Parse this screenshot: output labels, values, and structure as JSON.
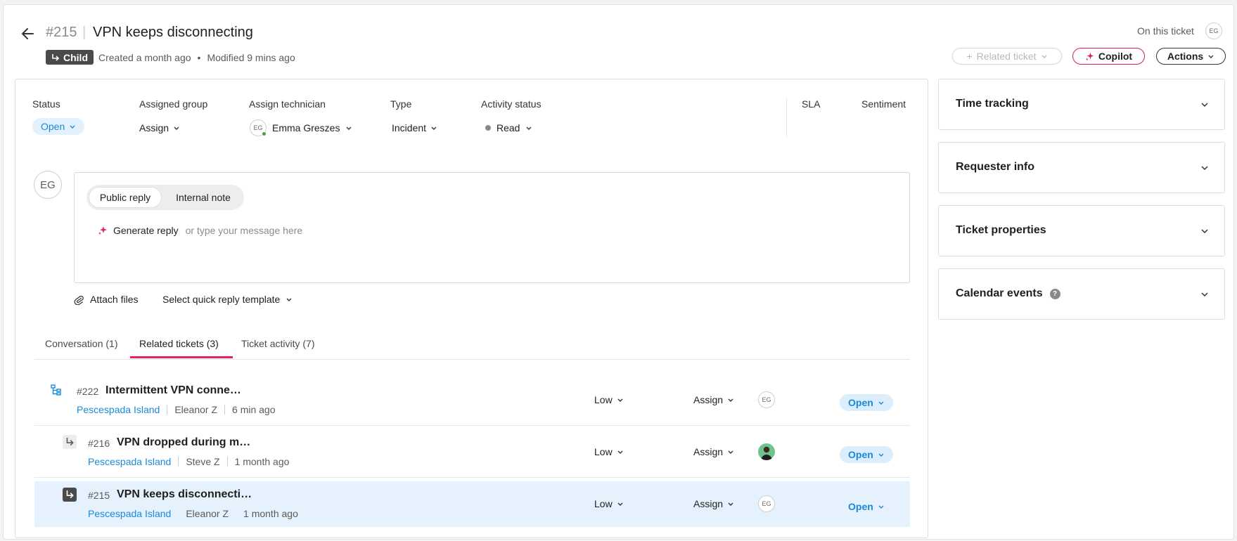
{
  "ticket": {
    "number": "#215",
    "separator": "|",
    "title": "VPN keeps disconnecting",
    "badge": "Child",
    "created": "Created a month ago",
    "dot": "•",
    "modified": "Modified 9 mins ago"
  },
  "header_right": {
    "on_this_ticket": "On this ticket",
    "avatar": "EG",
    "related_ticket": "Related ticket",
    "copilot": "Copilot",
    "actions": "Actions"
  },
  "fields": {
    "status_label": "Status",
    "status_value": "Open",
    "group_label": "Assigned group",
    "group_value": "Assign",
    "tech_label": "Assign technician",
    "tech_avatar": "EG",
    "tech_value": "Emma Greszes",
    "type_label": "Type",
    "type_value": "Incident",
    "activity_label": "Activity status",
    "activity_value": "Read",
    "sla_label": "SLA",
    "sentiment_label": "Sentiment"
  },
  "composer": {
    "avatar": "EG",
    "public_reply": "Public reply",
    "internal_note": "Internal note",
    "generate_reply": "Generate reply",
    "placeholder": "or type your message here",
    "attach_files": "Attach files",
    "quick_reply": "Select quick reply template"
  },
  "tabs": [
    {
      "label": "Conversation (1)"
    },
    {
      "label": "Related tickets (3)"
    },
    {
      "label": "Ticket activity (7)"
    }
  ],
  "related": [
    {
      "num": "#222",
      "title": "Intermittent VPN conne…",
      "site": "Pescespada Island",
      "person": "Eleanor Z",
      "time": "6 min ago",
      "priority": "Low",
      "assign": "Assign",
      "avatar": "EG",
      "status": "Open"
    },
    {
      "num": "#216",
      "title": "VPN dropped during m…",
      "site": "Pescespada Island",
      "person": "Steve Z",
      "time": "1 month ago",
      "priority": "Low",
      "assign": "Assign",
      "avatar": "",
      "status": "Open"
    },
    {
      "num": "#215",
      "title": "VPN keeps disconnecti…",
      "site": "Pescespada Island",
      "person": "Eleanor Z",
      "time": "1 month ago",
      "priority": "Low",
      "assign": "Assign",
      "avatar": "EG",
      "status": "Open"
    }
  ],
  "panels": [
    {
      "title": "Time tracking"
    },
    {
      "title": "Requester info"
    },
    {
      "title": "Ticket properties"
    },
    {
      "title": "Calendar events",
      "help": "?"
    }
  ],
  "colors": {
    "accent": "#e91e63",
    "link": "#1a8ad8",
    "status_bg": "#e3f1fc"
  }
}
